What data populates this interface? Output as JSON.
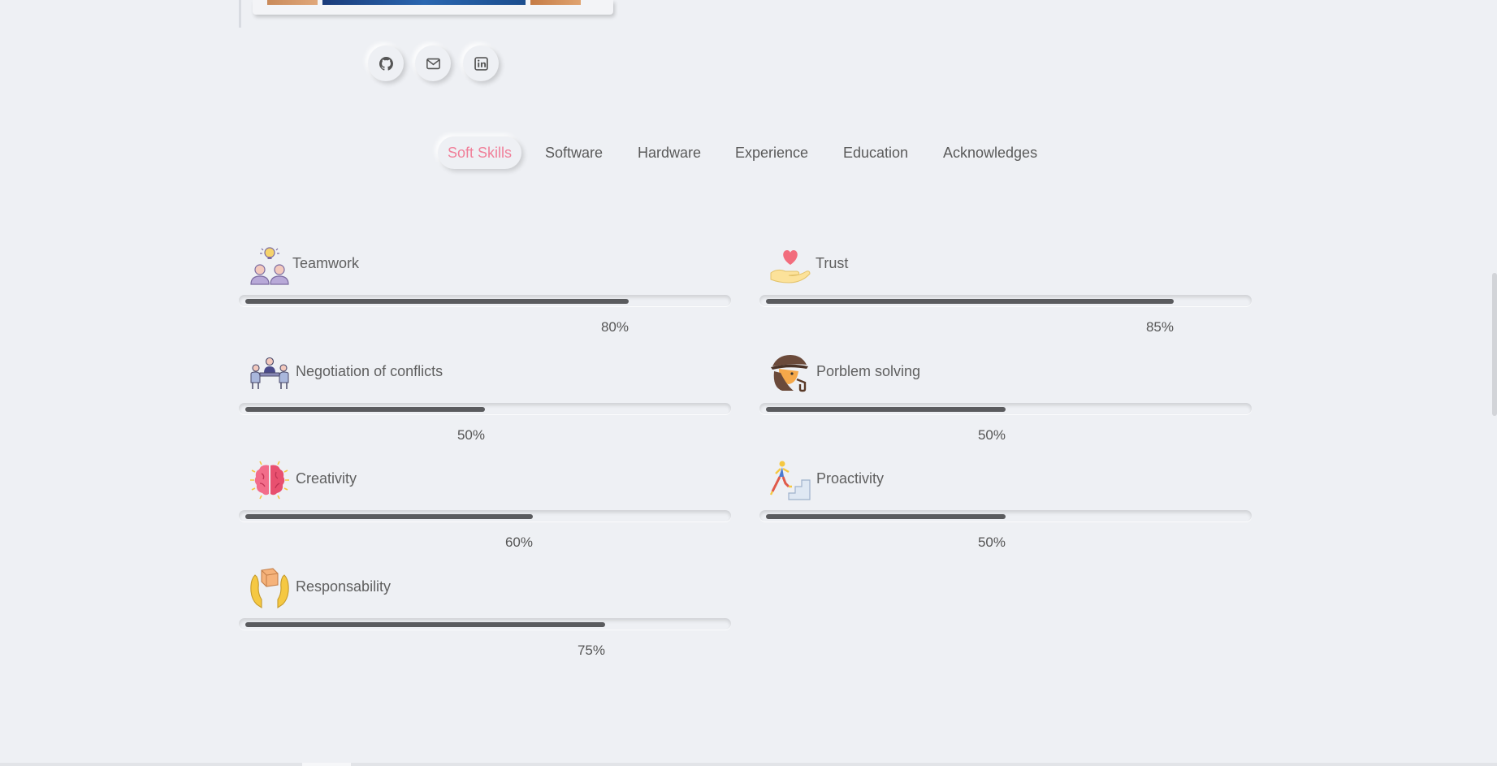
{
  "social": [
    {
      "name": "github-button",
      "icon": "github-icon"
    },
    {
      "name": "email-button",
      "icon": "mail-icon"
    },
    {
      "name": "linkedin-button",
      "icon": "linkedin-icon"
    }
  ],
  "tabs": [
    {
      "label": "Soft Skills",
      "active": true
    },
    {
      "label": "Software",
      "active": false
    },
    {
      "label": "Hardware",
      "active": false
    },
    {
      "label": "Experience",
      "active": false
    },
    {
      "label": "Education",
      "active": false
    },
    {
      "label": "Acknowledges",
      "active": false
    }
  ],
  "skills": [
    {
      "label": "Teamwork",
      "percent_text": "80%",
      "level": 0.8,
      "icon": "teamwork-icon"
    },
    {
      "label": "Trust",
      "percent_text": "85%",
      "level": 0.85,
      "icon": "trust-icon"
    },
    {
      "label": "Negotiation of conflicts",
      "percent_text": "50%",
      "level": 0.5,
      "icon": "negotiation-icon"
    },
    {
      "label": "Porblem solving",
      "percent_text": "50%",
      "level": 0.5,
      "icon": "detective-icon"
    },
    {
      "label": "Creativity",
      "percent_text": "60%",
      "level": 0.6,
      "icon": "brain-icon"
    },
    {
      "label": "Proactivity",
      "percent_text": "50%",
      "level": 0.5,
      "icon": "stairs-climber-icon"
    },
    {
      "label": "Responsability",
      "percent_text": "75%",
      "level": 0.75,
      "icon": "hands-box-icon"
    }
  ],
  "colors": {
    "background": "#eef0f4",
    "accent": "#f07f99",
    "bar_fill": "#5a5b5e"
  }
}
